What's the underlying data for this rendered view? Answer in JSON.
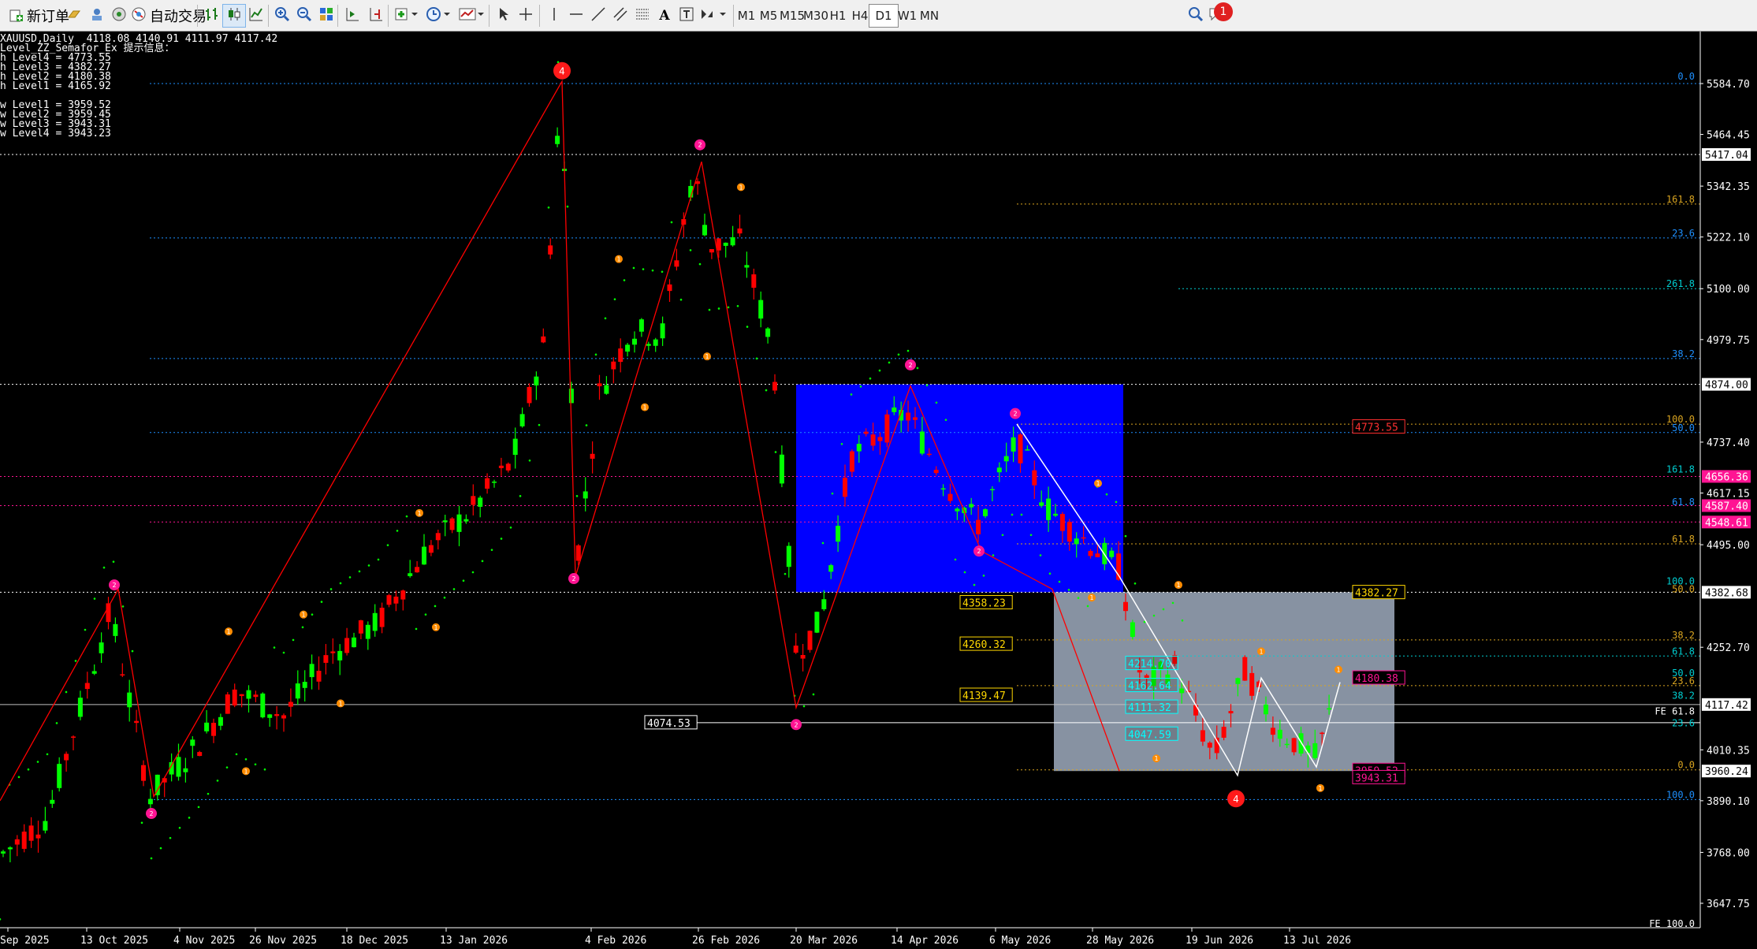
{
  "toolbar": {
    "new_order": "新订单",
    "auto_trade": "自动交易",
    "timeframes": [
      "M1",
      "M5",
      "M15",
      "M30",
      "H1",
      "H4",
      "D1",
      "W1",
      "MN"
    ],
    "active_timeframe": "D1",
    "notification_count": "1"
  },
  "header": {
    "symbol_line": "XAUUSD,Daily  4118.08 4140.91 4111.97 4117.42",
    "indicator_line": "Level_ZZ_Semafor_Ex 提示信息：",
    "levels": [
      "h Level4 = 4773.55",
      "h Level3 = 4382.27",
      "h Level2 = 4180.38",
      "h Level1 = 4165.92",
      "",
      "w Level1 = 3959.52",
      "w Level2 = 3959.45",
      "w Level3 = 3943.31",
      "w Level4 = 3943.23"
    ]
  },
  "price_axis": [
    "5584.70",
    "5464.45",
    "5342.35",
    "5222.10",
    "5100.00",
    "4979.75",
    "4737.40",
    "4617.15",
    "4495.00",
    "4252.70",
    "4010.35",
    "3890.10",
    "3768.00",
    "3647.75"
  ],
  "price_labels": [
    {
      "text": "5417.04",
      "price": 5417.04,
      "bg": "#ffffff",
      "fg": "#000000"
    },
    {
      "text": "4874.00",
      "price": 4874.0,
      "bg": "#ffffff",
      "fg": "#000000"
    },
    {
      "text": "4656.36",
      "price": 4656.36,
      "bg": "#ff1493",
      "fg": "#ffffff"
    },
    {
      "text": "4587.40",
      "price": 4587.4,
      "bg": "#ff1493",
      "fg": "#ffffff"
    },
    {
      "text": "4548.61",
      "price": 4548.61,
      "bg": "#ff1493",
      "fg": "#ffffff"
    },
    {
      "text": "4382.68",
      "price": 4382.68,
      "bg": "#ffffff",
      "fg": "#000000"
    },
    {
      "text": "4117.42",
      "price": 4117.42,
      "bg": "#ffffff",
      "fg": "#000000"
    },
    {
      "text": "3960.24",
      "price": 3960.24,
      "bg": "#ffffff",
      "fg": "#000000"
    }
  ],
  "date_axis": [
    "Sep 2025",
    "13 Oct 2025",
    "4 Nov 2025",
    "26 Nov 2025",
    "18 Dec 2025",
    "13 Jan 2026",
    "4 Feb 2026",
    "26 Feb 2026",
    "20 Mar 2026",
    "14 Apr 2026",
    "6 May 2026",
    "28 May 2026",
    "19 Jun 2026",
    "13 Jul 2026"
  ],
  "fib_labels_right": [
    {
      "text": "0.0",
      "price": 5590,
      "color": "#1e90ff"
    },
    {
      "text": "161.8",
      "price": 5300,
      "color": "#daa520"
    },
    {
      "text": "23.6",
      "price": 5220,
      "color": "#1e90ff"
    },
    {
      "text": "261.8",
      "price": 5100,
      "color": "#00ced1"
    },
    {
      "text": "38.2",
      "price": 4935,
      "color": "#1e90ff"
    },
    {
      "text": "100.0",
      "price": 4780,
      "color": "#daa520"
    },
    {
      "text": "50.0",
      "price": 4760,
      "color": "#1e90ff"
    },
    {
      "text": "161.8",
      "price": 4662,
      "color": "#00ced1"
    },
    {
      "text": "61.8",
      "price": 4585,
      "color": "#1e90ff"
    },
    {
      "text": "61.8",
      "price": 4497,
      "color": "#daa520"
    },
    {
      "text": "100.0",
      "price": 4397,
      "color": "#00ced1"
    },
    {
      "text": "50.0",
      "price": 4379,
      "color": "#daa520"
    },
    {
      "text": "38.2",
      "price": 4270,
      "color": "#daa520"
    },
    {
      "text": "61.8",
      "price": 4232,
      "color": "#00ced1"
    },
    {
      "text": "50.0",
      "price": 4180,
      "color": "#00ced1"
    },
    {
      "text": "23.6",
      "price": 4162,
      "color": "#daa520"
    },
    {
      "text": "38.2",
      "price": 4127,
      "color": "#00ced1"
    },
    {
      "text": "FE 61.8",
      "price": 4090,
      "color": "#ffffff"
    },
    {
      "text": "23.6",
      "price": 4062,
      "color": "#00ced1"
    },
    {
      "text": "0.0",
      "price": 3963,
      "color": "#daa520"
    },
    {
      "text": "100.0",
      "price": 3893,
      "color": "#1e90ff"
    },
    {
      "text": "FE 100.0",
      "price": 3588,
      "color": "#ffffff"
    }
  ],
  "box_labels": [
    {
      "text": "4358.23",
      "color": "#ffd700"
    },
    {
      "text": "4260.32",
      "color": "#ffd700"
    },
    {
      "text": "4139.47",
      "color": "#ffd700"
    },
    {
      "text": "4074.53",
      "color": "#ffffff"
    },
    {
      "text": "4773.55",
      "color": "#ff3030"
    },
    {
      "text": "4382.27",
      "color": "#ffd700"
    },
    {
      "text": "4180.38",
      "color": "#ff1493"
    },
    {
      "text": "3959.52",
      "color": "#ff1493"
    },
    {
      "text": "3943.31",
      "color": "#ff1493"
    },
    {
      "text": "4214.70",
      "color": "#00ffff"
    },
    {
      "text": "4162.64",
      "color": "#00ffff"
    },
    {
      "text": "4111.32",
      "color": "#00ffff"
    },
    {
      "text": "4047.59",
      "color": "#00ffff"
    }
  ],
  "semafor_labels": [
    "4",
    "2",
    "1"
  ],
  "colors": {
    "bull": "#00ff00",
    "bear": "#ff0000",
    "blue_box": "#0000ff",
    "grey_box": "#8e9aab",
    "zigzag": "#ff0000"
  }
}
